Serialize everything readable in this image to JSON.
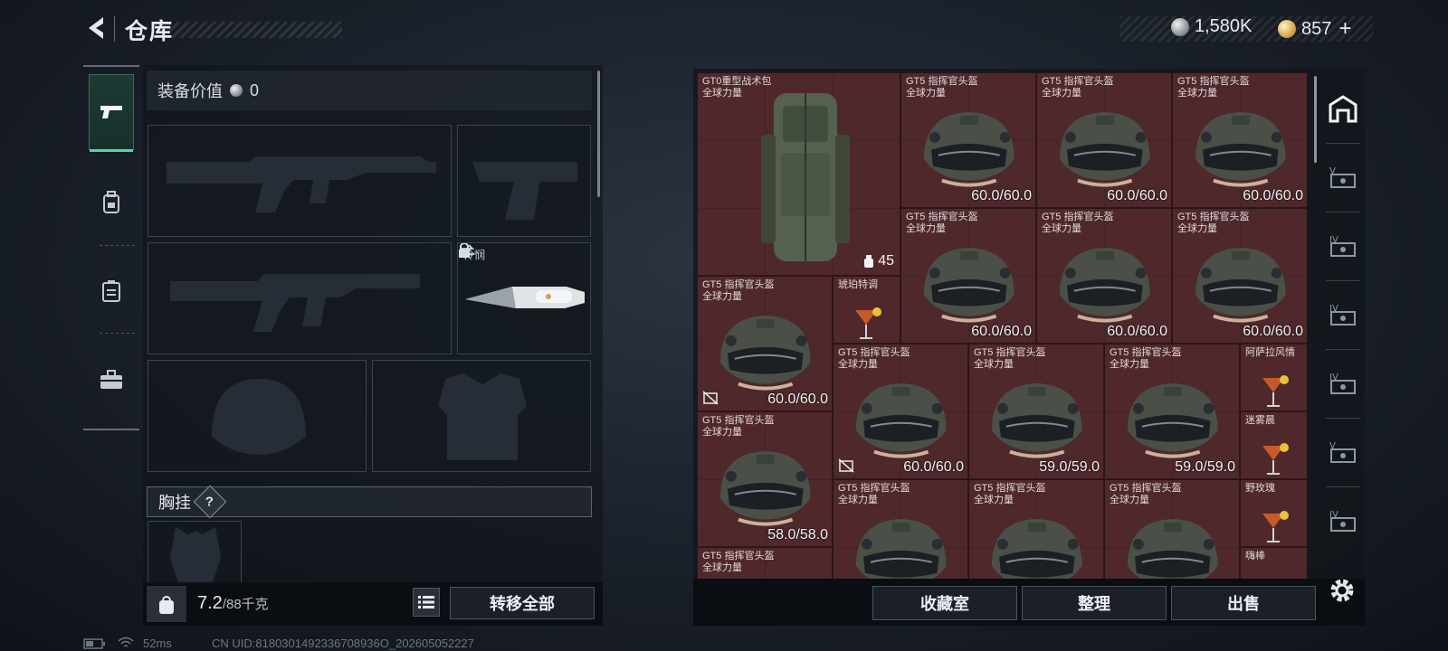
{
  "header": {
    "title": "仓库",
    "currency_silver": "1,580K",
    "currency_gold": "857",
    "plus_label": "+"
  },
  "loadout": {
    "equipment_value_label": "装备价值",
    "equipment_value": "0",
    "melee_slot_name": "怜悯",
    "vest_label": "胸挂",
    "vest_badge": "?",
    "weight_current": "7.2",
    "weight_max": "/88千克",
    "kg_icon_text": "KG",
    "transfer_all_label": "转移全部"
  },
  "storage": {
    "items": [
      {
        "name": "GT0重型战术包",
        "sub": "全球力量",
        "count": "45",
        "kind": "backpack"
      },
      {
        "name": "GT5 指挥官头盔",
        "sub": "全球力量",
        "durability": "60.0/60.0",
        "kind": "helmet"
      },
      {
        "name": "GT5 指挥官头盔",
        "sub": "全球力量",
        "durability": "60.0/60.0",
        "kind": "helmet"
      },
      {
        "name": "GT5 指挥官头盔",
        "sub": "全球力量",
        "durability": "60.0/60.0",
        "kind": "helmet"
      },
      {
        "name": "GT5 指挥官头盔",
        "sub": "全球力量",
        "durability": "60.0/60.0",
        "kind": "helmet"
      },
      {
        "name": "GT5 指挥官头盔",
        "sub": "全球力量",
        "durability": "60.0/60.0",
        "kind": "helmet"
      },
      {
        "name": "GT5 指挥官头盔",
        "sub": "全球力量",
        "durability": "60.0/60.0",
        "kind": "helmet"
      },
      {
        "name": "GT5 指挥官头盔",
        "sub": "全球力量",
        "durability": "60.0/60.0",
        "kind": "helmet"
      },
      {
        "name": "琥珀特调",
        "kind": "drink"
      },
      {
        "name": "GT5 指挥官头盔",
        "sub": "全球力量",
        "durability": "60.0/60.0",
        "kind": "helmet"
      },
      {
        "name": "GT5 指挥官头盔",
        "sub": "全球力量",
        "durability": "59.0/59.0",
        "kind": "helmet"
      },
      {
        "name": "GT5 指挥官头盔",
        "sub": "全球力量",
        "durability": "59.0/59.0",
        "kind": "helmet"
      },
      {
        "name": "阿萨拉风情",
        "kind": "drink"
      },
      {
        "name": "GT5 指挥官头盔",
        "sub": "全球力量",
        "durability": "58.0/58.0",
        "kind": "helmet"
      },
      {
        "name": "迷雾晨",
        "kind": "drink"
      },
      {
        "name": "GT5 指挥官头盔",
        "sub": "全球力量",
        "kind": "helmet"
      },
      {
        "name": "GT5 指挥官头盔",
        "sub": "全球力量",
        "kind": "helmet"
      },
      {
        "name": "GT5 指挥官头盔",
        "sub": "全球力量",
        "kind": "helmet"
      },
      {
        "name": "野玫瑰",
        "kind": "drink"
      },
      {
        "name": "GT5 指挥官头盔",
        "sub": "全球力量",
        "kind": "helmet"
      },
      {
        "name": "嗨棒",
        "kind": "drink"
      }
    ],
    "buttons": {
      "collection": "收藏室",
      "organize": "整理",
      "sell": "出售"
    },
    "side_tabs": [
      "home",
      "V",
      "IV",
      "IV",
      "IV",
      "V",
      "IV"
    ]
  },
  "status_bar": {
    "ping": "52ms",
    "uid": "CN UID:8180301492336708936O_202605052227"
  },
  "colors": {
    "grid_bg": "#4a2a2d",
    "accent_green": "#54d6a8"
  }
}
